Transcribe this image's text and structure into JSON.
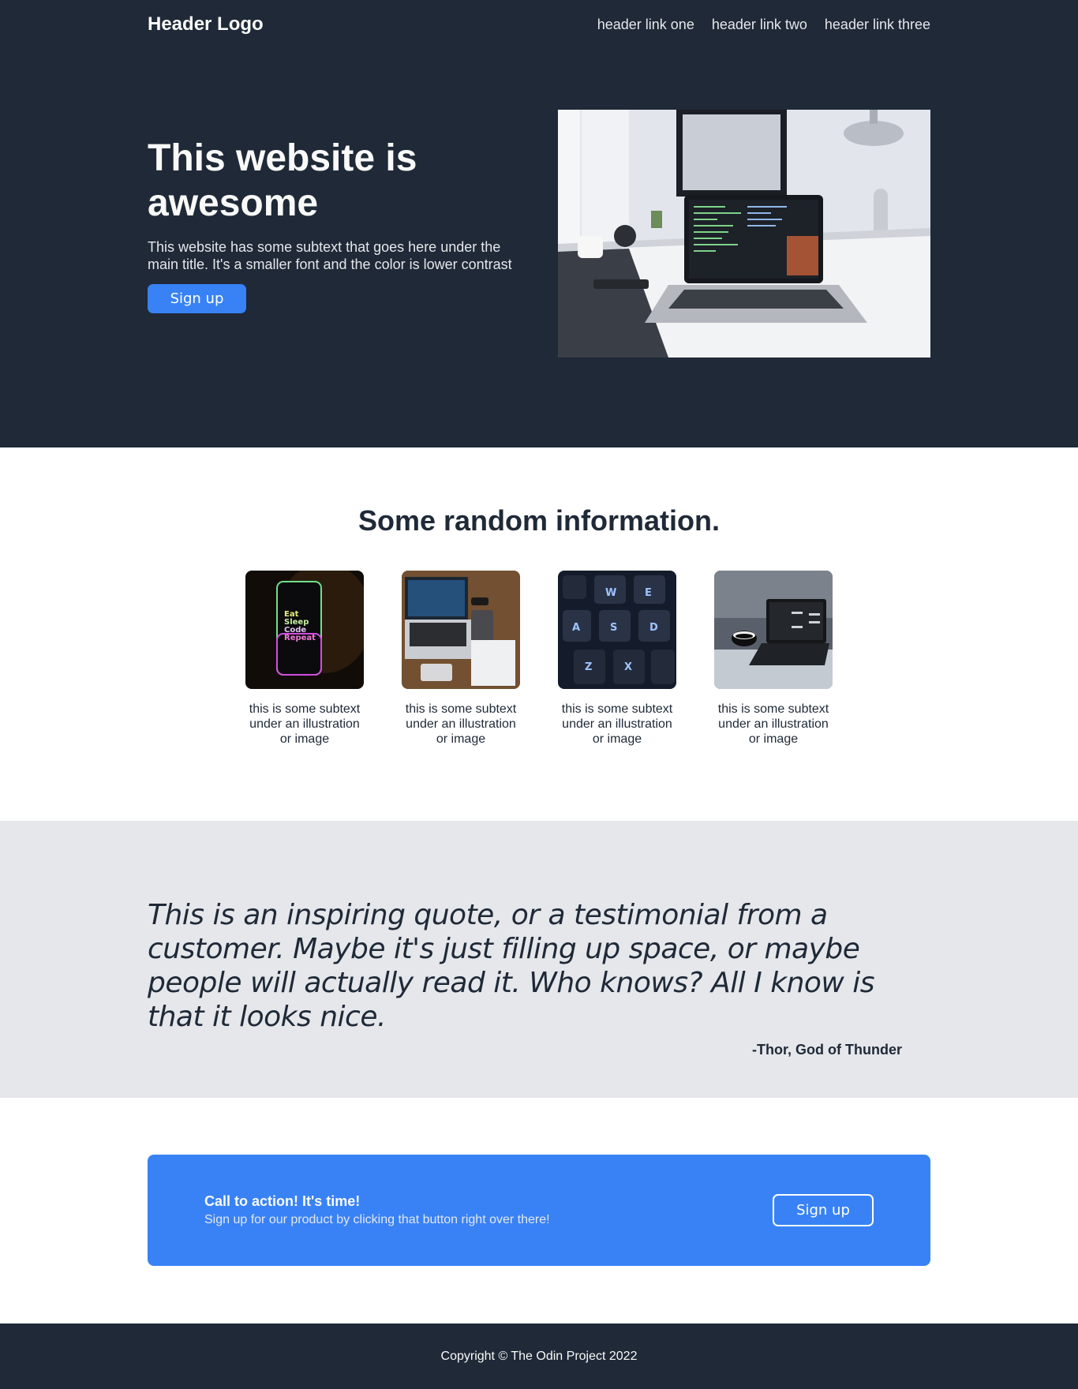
{
  "header": {
    "logo": "Header Logo",
    "links": [
      "header link one",
      "header link two",
      "header link three"
    ]
  },
  "hero": {
    "title": "This website is awesome",
    "subtext": "This website has some subtext that goes here under the main title. It's a smaller font and the color is lower contrast",
    "button_label": "Sign up"
  },
  "info": {
    "title": "Some random information.",
    "cards": [
      {
        "text": "this is some subtext under an illustration or image",
        "image_icon": "phone-icon"
      },
      {
        "text": "this is some subtext under an illustration or image",
        "image_icon": "laptop-desk-icon"
      },
      {
        "text": "this is some subtext under an illustration or image",
        "image_icon": "keyboard-icon"
      },
      {
        "text": "this is some subtext under an illustration or image",
        "image_icon": "laptop-bed-icon"
      }
    ],
    "phone_words": [
      "Eat",
      "Sleep",
      "Code",
      "Repeat"
    ]
  },
  "quote": {
    "text": "This is an inspiring quote, or a testimonial from a customer. Maybe it's just filling up space, or maybe people will actually read it. Who knows? All I know is that it looks nice.",
    "author": "-Thor, God of Thunder"
  },
  "cta": {
    "title": "Call to action! It's time!",
    "subtext": "Sign up for our product by clicking that button right over there!",
    "button_label": "Sign up"
  },
  "footer": {
    "copyright": "Copyright © The Odin Project 2022"
  },
  "colors": {
    "dark_bg": "#1f2937",
    "accent": "#3882f6",
    "light_gray": "#e5e7eb",
    "off_white": "#f9faf8"
  }
}
